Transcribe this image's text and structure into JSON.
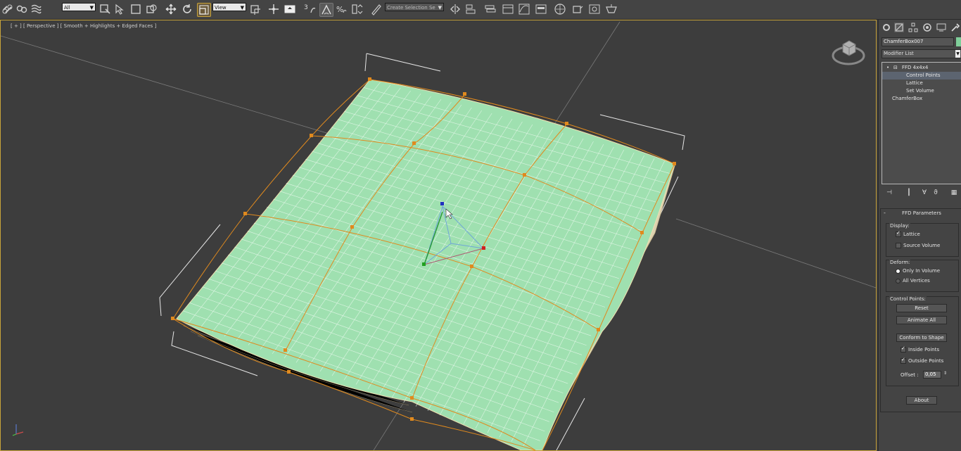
{
  "toolbar": {
    "selection_filter": "All",
    "reference_coord": "View",
    "named_selection_placeholder": "Create Selection Se",
    "snap_label": "3",
    "accent_color": "#c9a43a"
  },
  "viewport": {
    "label": "[ + ] [ Perspective ] [ Smooth + Highlights + Edged Faces ]",
    "active_border_color": "#c9a43a",
    "mesh_color": "#9fe0b0",
    "lattice_color": "#e08a1e"
  },
  "command_panel": {
    "object_name": "ChamferBox007",
    "object_color": "#7fcf9a",
    "modifier_list_label": "Modifier List",
    "stack": {
      "items": [
        {
          "label": "FFD 4x4x4",
          "level": 0,
          "selected": false
        },
        {
          "label": "Control Points",
          "level": 1,
          "selected": true
        },
        {
          "label": "Lattice",
          "level": 1,
          "selected": false
        },
        {
          "label": "Set Volume",
          "level": 1,
          "selected": false
        },
        {
          "label": "ChamferBox",
          "level": 0,
          "selected": false
        }
      ]
    },
    "ffd_parameters": {
      "title": "FFD Parameters",
      "display_group": "Display:",
      "lattice_label": "Lattice",
      "lattice_checked": true,
      "source_volume_label": "Source Volume",
      "source_volume_checked": false,
      "deform_group": "Deform:",
      "only_in_volume_label": "Only In Volume",
      "only_in_volume_selected": true,
      "all_vertices_label": "All Vertices",
      "all_vertices_selected": false,
      "control_points_group": "Control Points:",
      "reset_button": "Reset",
      "animate_all_button": "Animate All",
      "conform_button": "Conform to Shape",
      "inside_points_label": "Inside Points",
      "inside_points_checked": true,
      "outside_points_label": "Outside Points",
      "outside_points_checked": true,
      "offset_label": "Offset :",
      "offset_value": "0,05",
      "about_button": "About"
    }
  }
}
